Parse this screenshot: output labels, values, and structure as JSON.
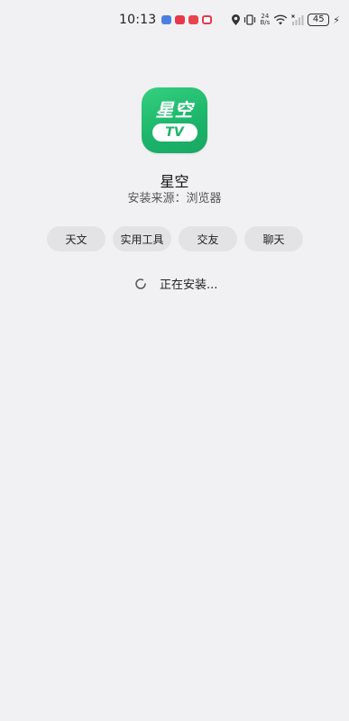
{
  "status_bar": {
    "time": "10:13",
    "net_speed_value": "24",
    "net_speed_unit": "B/s",
    "battery_level": "45"
  },
  "app": {
    "icon_title": "星空",
    "icon_subtitle": "TV",
    "name": "星空",
    "source": "安装来源：浏览器",
    "brand_color": "#1db46b"
  },
  "tags": [
    {
      "label": "天文"
    },
    {
      "label": "实用工具"
    },
    {
      "label": "交友"
    },
    {
      "label": "聊天"
    }
  ],
  "install": {
    "status_text": "正在安装..."
  }
}
